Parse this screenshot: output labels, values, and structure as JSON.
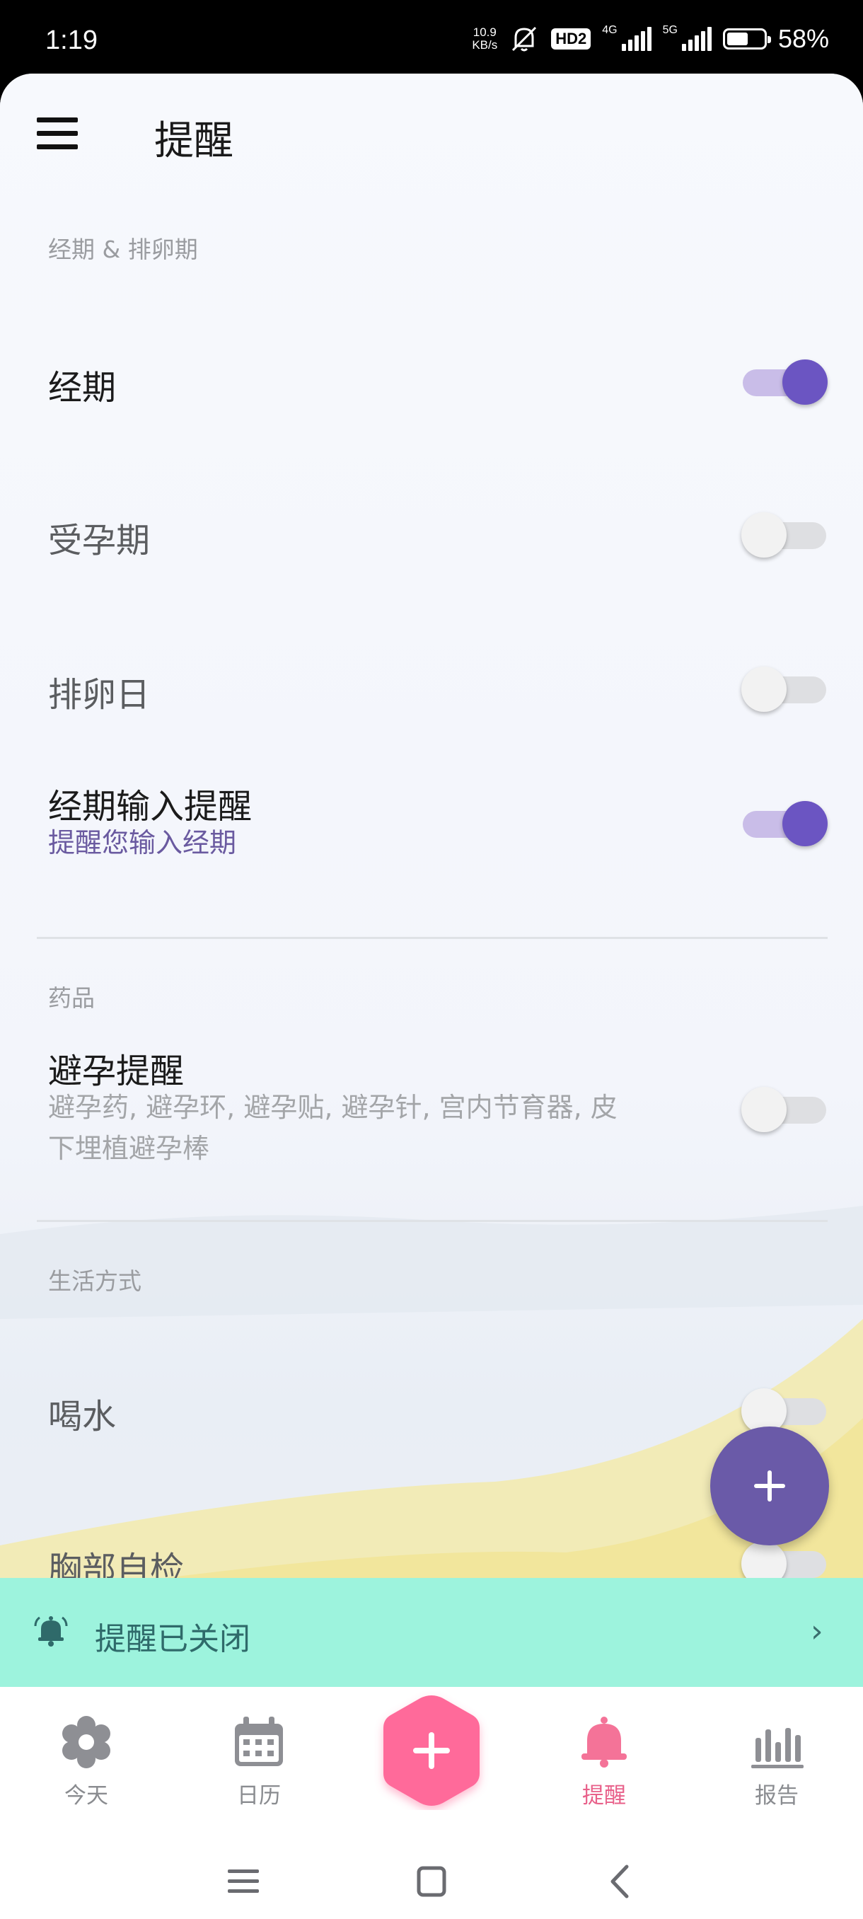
{
  "status_bar": {
    "time": "1:19",
    "net_speed_value": "10.9",
    "net_speed_unit": "KB/s",
    "hd_badge": "HD2",
    "signal1_label": "4G",
    "signal2_label": "5G",
    "battery_level": 0.58,
    "battery_text": "58%"
  },
  "header": {
    "title": "提醒",
    "menu_icon": "hamburger-menu-icon"
  },
  "sections": {
    "period": {
      "label": "经期 & 排卵期",
      "items": [
        {
          "title": "经期",
          "enabled": true
        },
        {
          "title": "受孕期",
          "enabled": false
        },
        {
          "title": "排卵日",
          "enabled": false
        },
        {
          "title": "经期输入提醒",
          "subtitle": "提醒您输入经期",
          "enabled": true
        }
      ]
    },
    "medicine": {
      "label": "药品",
      "items": [
        {
          "title": "避孕提醒",
          "subtitle_line1": "避孕药, 避孕环, 避孕贴, 避孕针, 宫内节育器, 皮",
          "subtitle_line2": "下埋植避孕棒",
          "enabled": false
        }
      ]
    },
    "lifestyle": {
      "label": "生活方式",
      "items": [
        {
          "title": "喝水",
          "enabled": false
        },
        {
          "title": "胸部自检",
          "enabled": false
        }
      ]
    }
  },
  "fab": {
    "icon": "plus-icon"
  },
  "banner": {
    "text": "提醒已关闭",
    "icon": "bell-icon",
    "chevron": "›"
  },
  "tabs": [
    {
      "label": "今天",
      "icon": "gear-flower-icon",
      "active": false
    },
    {
      "label": "日历",
      "icon": "calendar-icon",
      "active": false
    },
    {
      "label": "",
      "icon": "add-hexagon-icon",
      "active": false
    },
    {
      "label": "提醒",
      "icon": "bell-icon",
      "active": true
    },
    {
      "label": "报告",
      "icon": "bar-chart-icon",
      "active": false
    }
  ],
  "colors": {
    "accent_purple": "#6b55c2",
    "banner_mint": "#9df3dd",
    "active_pink": "#e8608a",
    "add_button_pink": "#ff6b9a"
  }
}
